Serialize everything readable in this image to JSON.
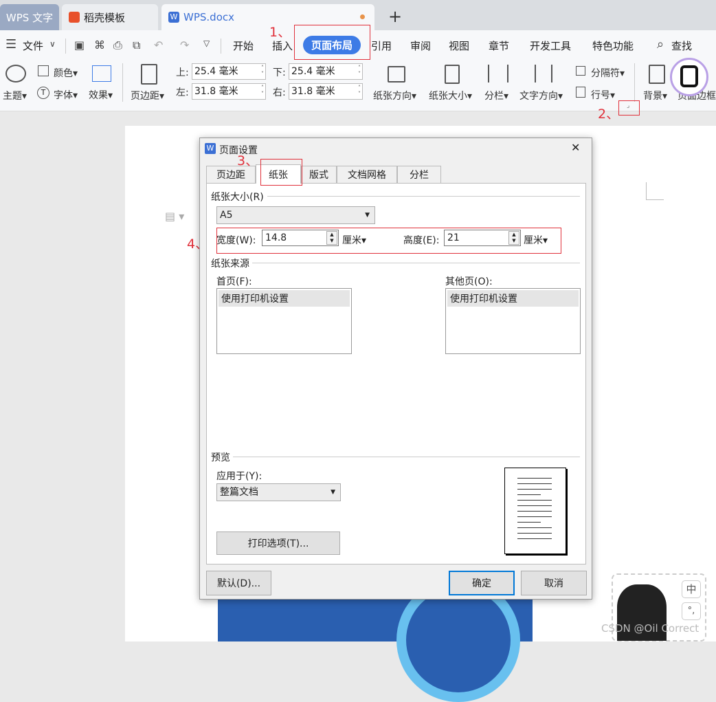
{
  "tabs": {
    "tab1": "WPS 文字",
    "tab2": "稻壳模板",
    "tab3": "WPS.docx",
    "add": "+"
  },
  "menubar": {
    "file": "文件",
    "items": [
      "开始",
      "插入",
      "页面布局",
      "引用",
      "审阅",
      "视图",
      "章节",
      "开发工具",
      "特色功能"
    ],
    "search": "查找"
  },
  "ribbon": {
    "theme": "主题",
    "color": "颜色",
    "font": "字体",
    "effect": "效果",
    "margins": "页边距",
    "top_label": "上:",
    "top_value": "25.4 毫米",
    "bottom_label": "下:",
    "bottom_value": "25.4 毫米",
    "left_label": "左:",
    "left_value": "31.8 毫米",
    "right_label": "右:",
    "right_value": "31.8 毫米",
    "orientation": "纸张方向",
    "size": "纸张大小",
    "columns": "分栏",
    "text_direction": "文字方向",
    "separator": "分隔符",
    "line_number": "行号",
    "background": "背景",
    "page_border": "页面边框"
  },
  "annotations": {
    "step1": "1、",
    "step2": "2、",
    "step3": "3、",
    "step4": "4、",
    "color": "#e0303a"
  },
  "dialog": {
    "title": "页面设置",
    "close": "✕",
    "tabs": [
      "页边距",
      "纸张",
      "版式",
      "文档网格",
      "分栏"
    ],
    "selected_tab": "纸张",
    "paper_size_label": "纸张大小(R)",
    "paper_size_value": "A5",
    "width_label": "宽度(W):",
    "width_value": "14.8",
    "width_unit": "厘米",
    "height_label": "高度(E):",
    "height_value": "21",
    "height_unit": "厘米",
    "source_label": "纸张来源",
    "first_page_label": "首页(F):",
    "first_page_item": "使用打印机设置",
    "other_pages_label": "其他页(O):",
    "other_pages_item": "使用打印机设置",
    "preview_label": "预览",
    "apply_label": "应用于(Y):",
    "apply_value": "整篇文档",
    "print_options": "打印选项(T)...",
    "default_button": "默认(D)...",
    "ok_button": "确定",
    "cancel_button": "取消"
  },
  "ime": {
    "lang": "中",
    "punct": "°,"
  },
  "watermark": "CSDN @Oil Correct"
}
